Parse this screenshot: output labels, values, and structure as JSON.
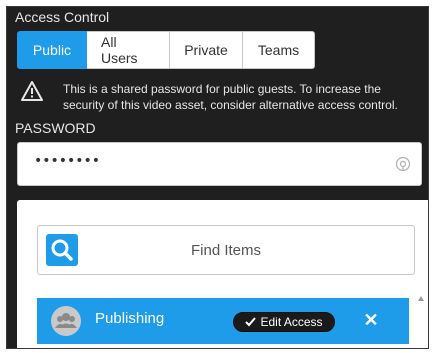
{
  "panel": {
    "title": "Access Control"
  },
  "tabs": [
    {
      "label": "Public",
      "active": true
    },
    {
      "label": "All Users",
      "active": false
    },
    {
      "label": "Private",
      "active": false
    },
    {
      "label": "Teams",
      "active": false
    }
  ],
  "warning": {
    "icon": "warning-triangle-icon",
    "text": "This is a shared password for public guests. To increase the security of this video asset, consider alternative access control."
  },
  "password": {
    "label": "PASSWORD",
    "value": "••••••••",
    "reveal_icon": "eye-icon"
  },
  "find": {
    "placeholder": "Find Items",
    "icon": "search-icon"
  },
  "list": {
    "items": [
      {
        "label": "Publishing",
        "avatar_icon": "group-icon",
        "action_label": "Edit Access",
        "remove_icon": "close-icon"
      }
    ]
  },
  "colors": {
    "accent": "#1e9be9",
    "panel_bg": "#1f1f1f",
    "pill_bg": "#1a1a1a"
  }
}
